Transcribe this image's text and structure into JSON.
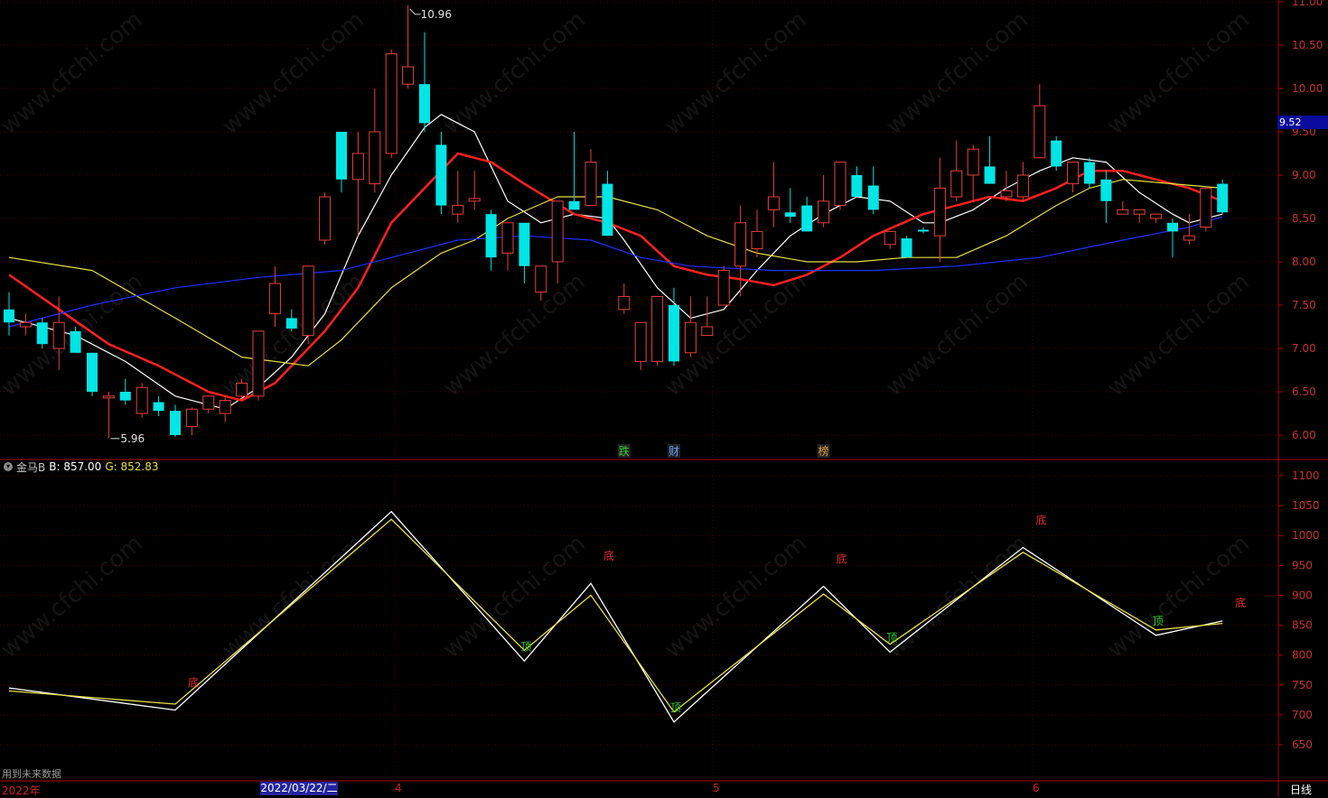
{
  "main_panel": {
    "price_ticks": [
      "11.00",
      "10.50",
      "10.00",
      "9.50",
      "9.00",
      "8.50",
      "8.00",
      "7.50",
      "7.00",
      "6.50",
      "6.00"
    ],
    "price_tag": "9.52",
    "high_label": "10.96",
    "low_label": "5.96",
    "event_marks": [
      {
        "text": "跌",
        "color": "#30d030"
      },
      {
        "text": "财",
        "color": "#60a0ff"
      },
      {
        "text": "榜",
        "color": "#e0a040"
      }
    ]
  },
  "sub_panel": {
    "indicator_name": "金马B",
    "b_label": "B: 857.00",
    "g_label": "G: 852.83",
    "ticks": [
      "1100",
      "1050",
      "1000",
      "950",
      "900",
      "850",
      "800",
      "750",
      "700",
      "650"
    ],
    "signals_top": [
      "顶",
      "顶",
      "顶",
      "顶"
    ],
    "signals_bottom": [
      "底",
      "底",
      "底",
      "底",
      "底"
    ]
  },
  "bottom_bar": {
    "start_label": "2022年",
    "date_cursor": "2022/03/22/二",
    "month_ticks": [
      "4",
      "5",
      "6"
    ],
    "period": "日线",
    "note": "用到未来数据"
  },
  "watermark": "www.cfchi.com",
  "colors": {
    "up": "#e8403a",
    "down": "#00e5e5",
    "ma5": "#ffffff",
    "ma10": "#ff2020",
    "ma20": "#e8e040",
    "ma60": "#2030ff",
    "axis": "#b00000",
    "b_line": "#ffffff",
    "g_line": "#e8e040"
  },
  "chart_data": [
    {
      "type": "candlestick",
      "ylim": [
        5.8,
        11.0
      ],
      "candles": [
        {
          "o": 7.45,
          "h": 7.65,
          "l": 7.15,
          "c": 7.3
        },
        {
          "o": 7.25,
          "h": 7.4,
          "l": 7.15,
          "c": 7.3
        },
        {
          "o": 7.3,
          "h": 7.35,
          "l": 7.0,
          "c": 7.05
        },
        {
          "o": 7.0,
          "h": 7.6,
          "l": 6.75,
          "c": 7.3
        },
        {
          "o": 7.2,
          "h": 7.25,
          "l": 6.95,
          "c": 6.95
        },
        {
          "o": 6.95,
          "h": 6.95,
          "l": 6.45,
          "c": 6.5
        },
        {
          "o": 6.45,
          "h": 6.5,
          "l": 5.96,
          "c": 6.45
        },
        {
          "o": 6.5,
          "h": 6.65,
          "l": 6.35,
          "c": 6.4
        },
        {
          "o": 6.25,
          "h": 6.6,
          "l": 6.2,
          "c": 6.55
        },
        {
          "o": 6.38,
          "h": 6.45,
          "l": 6.22,
          "c": 6.28
        },
        {
          "o": 6.28,
          "h": 6.35,
          "l": 5.98,
          "c": 6.0
        },
        {
          "o": 6.1,
          "h": 6.32,
          "l": 6.0,
          "c": 6.3
        },
        {
          "o": 6.3,
          "h": 6.45,
          "l": 6.25,
          "c": 6.45
        },
        {
          "o": 6.25,
          "h": 6.45,
          "l": 6.15,
          "c": 6.4
        },
        {
          "o": 6.45,
          "h": 6.65,
          "l": 6.4,
          "c": 6.6
        },
        {
          "o": 6.45,
          "h": 7.2,
          "l": 6.4,
          "c": 7.2
        },
        {
          "o": 7.4,
          "h": 7.95,
          "l": 7.25,
          "c": 7.75
        },
        {
          "o": 7.35,
          "h": 7.45,
          "l": 7.2,
          "c": 7.23
        },
        {
          "o": 7.15,
          "h": 7.95,
          "l": 7.05,
          "c": 7.95
        },
        {
          "o": 8.25,
          "h": 8.8,
          "l": 8.2,
          "c": 8.75
        },
        {
          "o": 9.5,
          "h": 9.5,
          "l": 8.8,
          "c": 8.95
        },
        {
          "o": 8.95,
          "h": 9.5,
          "l": 8.3,
          "c": 9.25
        },
        {
          "o": 8.9,
          "h": 10.0,
          "l": 8.8,
          "c": 9.5
        },
        {
          "o": 9.25,
          "h": 10.45,
          "l": 9.2,
          "c": 10.4
        },
        {
          "o": 10.05,
          "h": 10.96,
          "l": 10.0,
          "c": 10.25
        },
        {
          "o": 10.05,
          "h": 10.65,
          "l": 9.5,
          "c": 9.6
        },
        {
          "o": 9.35,
          "h": 9.5,
          "l": 8.55,
          "c": 8.65
        },
        {
          "o": 8.55,
          "h": 9.05,
          "l": 8.45,
          "c": 8.65
        },
        {
          "o": 8.7,
          "h": 9.05,
          "l": 8.6,
          "c": 8.73
        },
        {
          "o": 8.55,
          "h": 8.6,
          "l": 7.9,
          "c": 8.05
        },
        {
          "o": 8.1,
          "h": 8.45,
          "l": 7.9,
          "c": 8.45
        },
        {
          "o": 8.45,
          "h": 8.45,
          "l": 7.75,
          "c": 7.95
        },
        {
          "o": 7.65,
          "h": 7.95,
          "l": 7.55,
          "c": 7.95
        },
        {
          "o": 8.0,
          "h": 8.55,
          "l": 7.75,
          "c": 8.7
        },
        {
          "o": 8.7,
          "h": 9.5,
          "l": 8.6,
          "c": 8.6
        },
        {
          "o": 8.65,
          "h": 9.3,
          "l": 8.65,
          "c": 9.15
        },
        {
          "o": 8.9,
          "h": 9.05,
          "l": 8.3,
          "c": 8.3
        },
        {
          "o": 7.45,
          "h": 7.75,
          "l": 7.4,
          "c": 7.6
        },
        {
          "o": 6.85,
          "h": 7.25,
          "l": 6.75,
          "c": 7.3
        },
        {
          "o": 6.85,
          "h": 7.6,
          "l": 6.8,
          "c": 7.6
        },
        {
          "o": 7.5,
          "h": 7.7,
          "l": 6.8,
          "c": 6.85
        },
        {
          "o": 6.95,
          "h": 7.6,
          "l": 6.9,
          "c": 7.3
        },
        {
          "o": 7.15,
          "h": 7.6,
          "l": 7.15,
          "c": 7.25
        },
        {
          "o": 7.5,
          "h": 7.95,
          "l": 7.5,
          "c": 7.9
        },
        {
          "o": 7.95,
          "h": 8.65,
          "l": 7.6,
          "c": 8.45
        },
        {
          "o": 8.15,
          "h": 8.6,
          "l": 8.05,
          "c": 8.35
        },
        {
          "o": 8.6,
          "h": 9.15,
          "l": 8.4,
          "c": 8.75
        },
        {
          "o": 8.57,
          "h": 8.85,
          "l": 8.45,
          "c": 8.52
        },
        {
          "o": 8.65,
          "h": 8.75,
          "l": 8.35,
          "c": 8.35
        },
        {
          "o": 8.45,
          "h": 9.0,
          "l": 8.4,
          "c": 8.7
        },
        {
          "o": 8.65,
          "h": 9.15,
          "l": 8.6,
          "c": 9.15
        },
        {
          "o": 9.0,
          "h": 9.1,
          "l": 8.75,
          "c": 8.75
        },
        {
          "o": 8.88,
          "h": 9.1,
          "l": 8.55,
          "c": 8.6
        },
        {
          "o": 8.2,
          "h": 8.35,
          "l": 8.15,
          "c": 8.35
        },
        {
          "o": 8.27,
          "h": 8.3,
          "l": 8.05,
          "c": 8.05
        },
        {
          "o": 8.37,
          "h": 8.4,
          "l": 8.33,
          "c": 8.35
        },
        {
          "o": 8.3,
          "h": 9.2,
          "l": 8.0,
          "c": 8.85
        },
        {
          "o": 8.75,
          "h": 9.4,
          "l": 8.7,
          "c": 9.05
        },
        {
          "o": 9.0,
          "h": 9.35,
          "l": 8.7,
          "c": 9.3
        },
        {
          "o": 9.1,
          "h": 9.45,
          "l": 8.9,
          "c": 8.9
        },
        {
          "o": 8.75,
          "h": 9.05,
          "l": 8.7,
          "c": 8.82
        },
        {
          "o": 8.75,
          "h": 9.15,
          "l": 8.7,
          "c": 9.0
        },
        {
          "o": 9.2,
          "h": 10.05,
          "l": 9.2,
          "c": 9.8
        },
        {
          "o": 9.4,
          "h": 9.45,
          "l": 9.05,
          "c": 9.1
        },
        {
          "o": 8.9,
          "h": 9.15,
          "l": 8.8,
          "c": 9.15
        },
        {
          "o": 9.15,
          "h": 9.2,
          "l": 8.85,
          "c": 8.9
        },
        {
          "o": 8.95,
          "h": 9.05,
          "l": 8.45,
          "c": 8.7
        },
        {
          "o": 8.55,
          "h": 8.7,
          "l": 8.55,
          "c": 8.6
        },
        {
          "o": 8.55,
          "h": 8.6,
          "l": 8.45,
          "c": 8.6
        },
        {
          "o": 8.5,
          "h": 8.55,
          "l": 8.45,
          "c": 8.55
        },
        {
          "o": 8.45,
          "h": 8.5,
          "l": 8.05,
          "c": 8.35
        },
        {
          "o": 8.25,
          "h": 8.55,
          "l": 8.2,
          "c": 8.3
        },
        {
          "o": 8.4,
          "h": 8.85,
          "l": 8.35,
          "c": 8.85
        },
        {
          "o": 8.9,
          "h": 8.95,
          "l": 8.55,
          "c": 8.57
        }
      ],
      "ma": [
        {
          "name": "MA5",
          "color": "#ffffff",
          "values": [
            [
              0,
              7.35
            ],
            [
              4,
              7.15
            ],
            [
              7,
              6.85
            ],
            [
              10,
              6.45
            ],
            [
              13,
              6.3
            ],
            [
              15,
              6.55
            ],
            [
              17,
              6.9
            ],
            [
              19,
              7.4
            ],
            [
              21,
              8.3
            ],
            [
              23,
              9.0
            ],
            [
              25,
              9.55
            ],
            [
              26,
              9.7
            ],
            [
              28,
              9.5
            ],
            [
              30,
              8.7
            ],
            [
              32,
              8.45
            ],
            [
              34,
              8.55
            ],
            [
              36,
              8.5
            ],
            [
              37,
              8.25
            ],
            [
              39,
              7.7
            ],
            [
              41,
              7.35
            ],
            [
              43,
              7.45
            ],
            [
              45,
              7.9
            ],
            [
              47,
              8.3
            ],
            [
              49,
              8.55
            ],
            [
              51,
              8.75
            ],
            [
              53,
              8.7
            ],
            [
              55,
              8.45
            ],
            [
              56,
              8.45
            ],
            [
              58,
              8.6
            ],
            [
              60,
              8.85
            ],
            [
              62,
              9.05
            ],
            [
              64,
              9.2
            ],
            [
              66,
              9.15
            ],
            [
              68,
              8.8
            ],
            [
              70,
              8.55
            ],
            [
              71,
              8.45
            ],
            [
              73,
              8.55
            ]
          ]
        },
        {
          "name": "MA10",
          "color": "#ff2020",
          "values": [
            [
              0,
              7.85
            ],
            [
              3,
              7.45
            ],
            [
              6,
              7.05
            ],
            [
              9,
              6.8
            ],
            [
              12,
              6.5
            ],
            [
              14,
              6.4
            ],
            [
              16,
              6.6
            ],
            [
              19,
              7.2
            ],
            [
              21,
              7.7
            ],
            [
              23,
              8.45
            ],
            [
              25,
              8.85
            ],
            [
              27,
              9.25
            ],
            [
              29,
              9.15
            ],
            [
              31,
              8.9
            ],
            [
              34,
              8.55
            ],
            [
              36,
              8.45
            ],
            [
              38,
              8.3
            ],
            [
              40,
              7.95
            ],
            [
              42,
              7.85
            ],
            [
              44,
              7.8
            ],
            [
              46,
              7.73
            ],
            [
              48,
              7.85
            ],
            [
              50,
              8.05
            ],
            [
              52,
              8.3
            ],
            [
              55,
              8.55
            ],
            [
              57,
              8.65
            ],
            [
              59,
              8.75
            ],
            [
              61,
              8.7
            ],
            [
              63,
              8.85
            ],
            [
              65,
              9.05
            ],
            [
              67,
              9.05
            ],
            [
              69,
              8.95
            ],
            [
              71,
              8.85
            ],
            [
              73,
              8.7
            ]
          ]
        },
        {
          "name": "MA20",
          "color": "#e8e040",
          "values": [
            [
              0,
              8.05
            ],
            [
              5,
              7.9
            ],
            [
              10,
              7.35
            ],
            [
              14,
              6.9
            ],
            [
              18,
              6.8
            ],
            [
              20,
              7.1
            ],
            [
              23,
              7.7
            ],
            [
              26,
              8.1
            ],
            [
              28,
              8.25
            ],
            [
              30,
              8.5
            ],
            [
              33,
              8.75
            ],
            [
              36,
              8.75
            ],
            [
              39,
              8.6
            ],
            [
              42,
              8.3
            ],
            [
              45,
              8.1
            ],
            [
              48,
              8.0
            ],
            [
              51,
              8.0
            ],
            [
              54,
              8.05
            ],
            [
              57,
              8.05
            ],
            [
              60,
              8.3
            ],
            [
              63,
              8.65
            ],
            [
              65,
              8.85
            ],
            [
              67,
              8.95
            ],
            [
              70,
              8.9
            ],
            [
              73,
              8.85
            ]
          ]
        },
        {
          "name": "MA60",
          "color": "#2030ff",
          "values": [
            [
              0,
              7.25
            ],
            [
              5,
              7.5
            ],
            [
              10,
              7.7
            ],
            [
              15,
              7.82
            ],
            [
              20,
              7.9
            ],
            [
              24,
              8.1
            ],
            [
              27,
              8.25
            ],
            [
              31,
              8.3
            ],
            [
              35,
              8.25
            ],
            [
              38,
              8.05
            ],
            [
              41,
              7.95
            ],
            [
              46,
              7.9
            ],
            [
              52,
              7.9
            ],
            [
              57,
              7.95
            ],
            [
              62,
              8.05
            ],
            [
              67,
              8.25
            ],
            [
              71,
              8.4
            ],
            [
              73,
              8.52
            ]
          ]
        }
      ]
    },
    {
      "type": "line",
      "ylim": [
        600,
        1130
      ],
      "series": [
        {
          "name": "B",
          "color": "#ffffff",
          "values": [
            [
              0,
              745
            ],
            [
              10,
              708
            ],
            [
              23,
              1040
            ],
            [
              31,
              790
            ],
            [
              35,
              920
            ],
            [
              40,
              688
            ],
            [
              49,
              915
            ],
            [
              53,
              805
            ],
            [
              61,
              980
            ],
            [
              69,
              833
            ],
            [
              73,
              857
            ]
          ]
        },
        {
          "name": "G",
          "color": "#e8e040",
          "values": [
            [
              0,
              740
            ],
            [
              10,
              718
            ],
            [
              23,
              1027
            ],
            [
              31,
              808
            ],
            [
              35,
              900
            ],
            [
              40,
              705
            ],
            [
              49,
              902
            ],
            [
              53,
              818
            ],
            [
              61,
              972
            ],
            [
              69,
              842
            ],
            [
              73,
              853
            ]
          ]
        }
      ]
    }
  ]
}
